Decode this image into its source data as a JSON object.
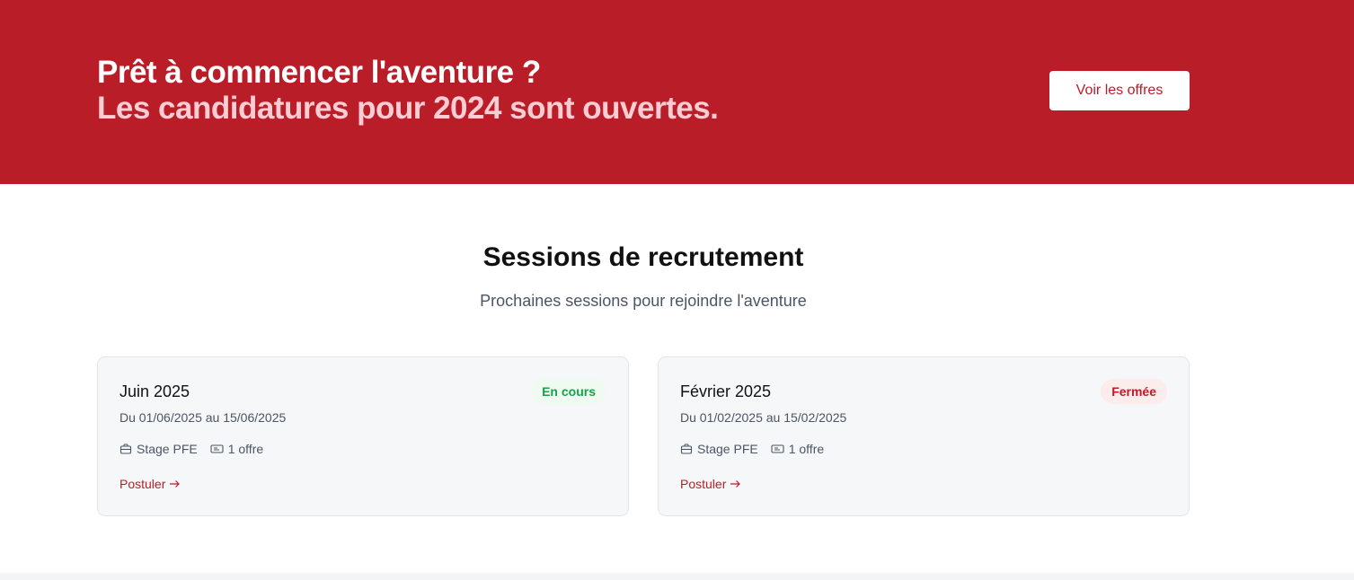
{
  "hero": {
    "title": "Prêt à commencer l'aventure ?",
    "subtitle": "Les candidatures pour 2024 sont ouvertes.",
    "button_label": "Voir les offres"
  },
  "sessions": {
    "title": "Sessions de recrutement",
    "subtitle": "Prochaines sessions pour rejoindre l'aventure",
    "cards": [
      {
        "title": "Juin 2025",
        "status": "En cours",
        "dates": "Du 01/06/2025 au 15/06/2025",
        "type_label": "Stage PFE",
        "offers_label": "1 offre",
        "link_label": "Postuler"
      },
      {
        "title": "Février 2025",
        "status": "Fermée",
        "dates": "Du 01/02/2025 au 15/02/2025",
        "type_label": "Stage PFE",
        "offers_label": "1 offre",
        "link_label": "Postuler"
      }
    ]
  },
  "colors": {
    "brand_red": "#b91d28",
    "open_green": "#17a34a",
    "subtitle_pink": "#fecdd3"
  }
}
